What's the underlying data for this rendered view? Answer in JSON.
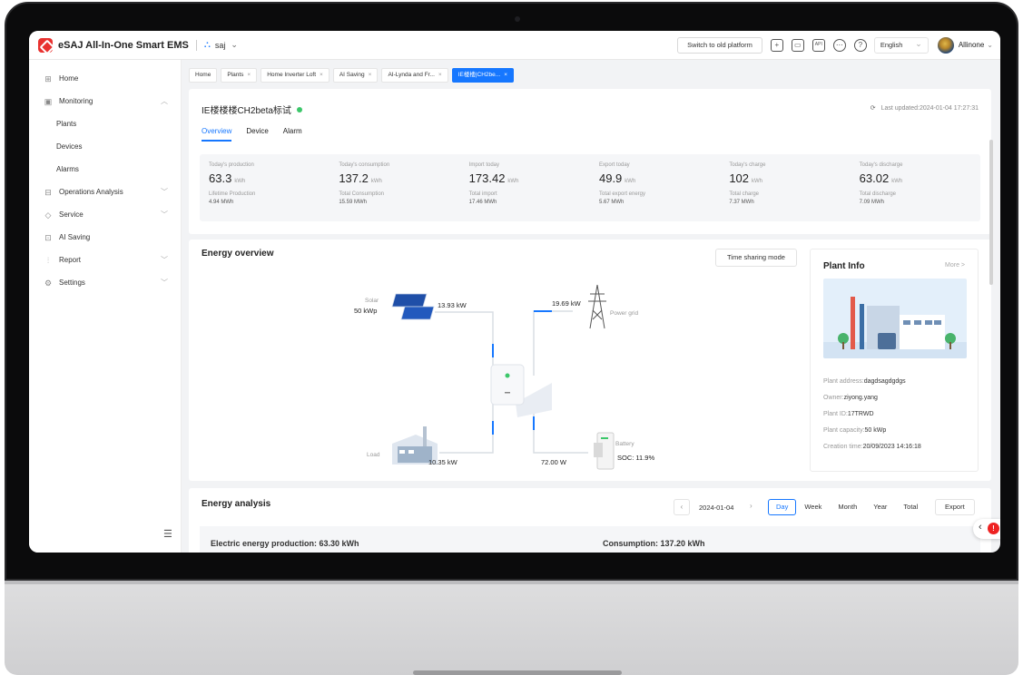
{
  "app": {
    "title": "eSAJ All-In-One Smart EMS",
    "plant_selector": "saj"
  },
  "topbar": {
    "old_platform": "Switch to old platform",
    "language": "English",
    "user": "Allinone"
  },
  "sidebar": {
    "items": [
      {
        "label": "Home",
        "icon": "grid-icon"
      },
      {
        "label": "Monitoring",
        "icon": "monitor-icon",
        "expandable": true,
        "expanded": true
      },
      {
        "label": "Plants",
        "sub": true
      },
      {
        "label": "Devices",
        "sub": true
      },
      {
        "label": "Alarms",
        "sub": true
      },
      {
        "label": "Operations Analysis",
        "icon": "analysis-icon",
        "expandable": true
      },
      {
        "label": "Service",
        "icon": "service-icon",
        "expandable": true
      },
      {
        "label": "AI Saving",
        "icon": "ai-icon"
      },
      {
        "label": "Report",
        "icon": "report-icon",
        "expandable": true
      },
      {
        "label": "Settings",
        "icon": "settings-icon",
        "expandable": true
      }
    ]
  },
  "tabs": [
    {
      "label": "Home",
      "closable": false
    },
    {
      "label": "Plants",
      "closable": true
    },
    {
      "label": "Home Inverter Loft",
      "closable": true
    },
    {
      "label": "AI Saving",
      "closable": true
    },
    {
      "label": "AI-Lynda and Fr...",
      "closable": true
    },
    {
      "label": "IE楼楼|CH2be...",
      "closable": true,
      "active": true
    }
  ],
  "plant": {
    "name": "IE楼楼楼CH2beta标试",
    "status_color": "#3cc76a",
    "last_updated": "Last updated:2024-01-04 17:27:31",
    "subtabs": [
      "Overview",
      "Device",
      "Alarm"
    ]
  },
  "stats": [
    {
      "label": "Today's production",
      "value": "63.3",
      "unit": "kWh",
      "label2": "Lifetime Production",
      "value2": "4.94 MWh"
    },
    {
      "label": "Today's consumption",
      "value": "137.2",
      "unit": "kWh",
      "label2": "Total Consumption",
      "value2": "15.59 MWh"
    },
    {
      "label": "Import today",
      "value": "173.42",
      "unit": "kWh",
      "label2": "Total import",
      "value2": "17.46 MWh"
    },
    {
      "label": "Export today",
      "value": "49.9",
      "unit": "kWh",
      "label2": "Total export energy",
      "value2": "5.67 MWh"
    },
    {
      "label": "Today's charge",
      "value": "102",
      "unit": "kWh",
      "label2": "Total charge",
      "value2": "7.37 MWh"
    },
    {
      "label": "Today's discharge",
      "value": "63.02",
      "unit": "kWh",
      "label2": "Total discharge",
      "value2": "7.09 MWh"
    }
  ],
  "overview": {
    "title": "Energy overview",
    "mode_button": "Time sharing mode",
    "solar_label": "Solar",
    "solar_capacity": "50 kWp",
    "solar_power": "13.93 kW",
    "grid_power": "19.69 kW",
    "grid_label": "Power grid",
    "load_label": "Load",
    "load_power": "10.35 kW",
    "battery_label": "Battery",
    "battery_power": "72.00 W",
    "soc": "SOC:  11.9%",
    "accent": "#1677ff"
  },
  "plant_info": {
    "title": "Plant Info",
    "more": "More >",
    "address_label": "Plant address:",
    "address": "dagdsagdgdgs",
    "owner_label": "Owner:",
    "owner": "ziyong.yang",
    "id_label": "Plant ID:",
    "id": "17TRWD",
    "capacity_label": "Plant capacity:",
    "capacity": "50 kWp",
    "created_label": "Creation time:",
    "created": "20/09/2023 14:16:18"
  },
  "analysis": {
    "title": "Energy analysis",
    "date": "2024-01-04",
    "periods": [
      "Day",
      "Week",
      "Month",
      "Year",
      "Total"
    ],
    "active_period": "Day",
    "export": "Export",
    "production_text": "Electric energy production: 63.30 kWh",
    "consumption_text": "Consumption: 137.20 kWh"
  }
}
